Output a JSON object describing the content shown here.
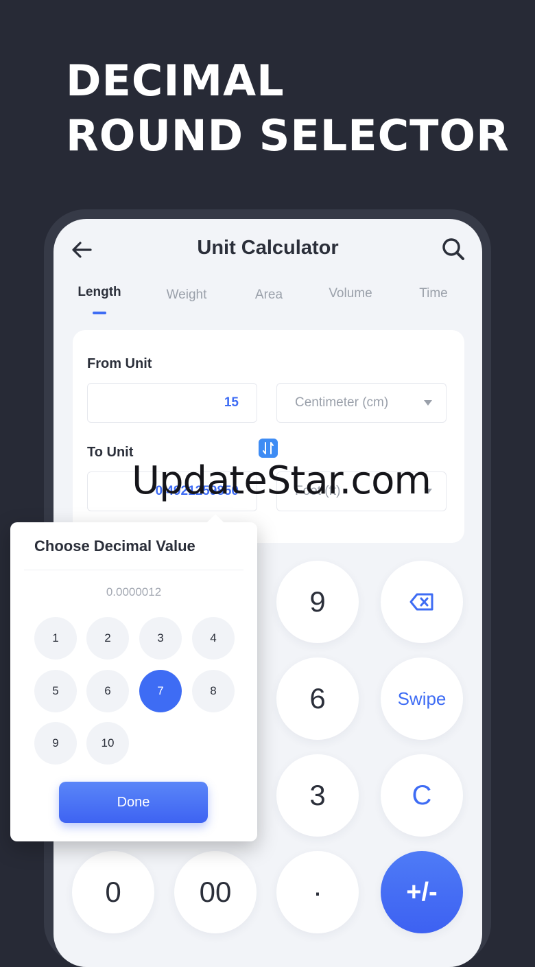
{
  "headline": {
    "line1": "DECIMAL",
    "line2": "ROUND SELECTOR"
  },
  "app": {
    "title": "Unit Calculator"
  },
  "tabs": [
    {
      "label": "Length",
      "active": true
    },
    {
      "label": "Weight",
      "active": false
    },
    {
      "label": "Area",
      "active": false
    },
    {
      "label": "Volume",
      "active": false
    },
    {
      "label": "Time",
      "active": false
    }
  ],
  "converter": {
    "from_label": "From Unit",
    "from_value": "15",
    "from_unit": "Centimeter (cm)",
    "to_label": "To Unit",
    "to_value": "0.4921259850",
    "to_unit": "Foot (ft)"
  },
  "keypad": {
    "k9": "9",
    "backspace_icon": "backspace-icon",
    "k6": "6",
    "swipe": "Swipe",
    "k3": "3",
    "clear": "C",
    "k0": "0",
    "k00": "00",
    "dot": "·",
    "plusminus": "+/-"
  },
  "decimal_popup": {
    "title": "Choose Decimal Value",
    "preview": "0.0000012",
    "options": [
      "1",
      "2",
      "3",
      "4",
      "5",
      "6",
      "7",
      "8",
      "9",
      "10"
    ],
    "selected": "7",
    "done_label": "Done"
  },
  "watermark": "UpdateStar.com",
  "colors": {
    "accent": "#3e6cf4",
    "background": "#272a36",
    "screen": "#f2f4f8"
  }
}
